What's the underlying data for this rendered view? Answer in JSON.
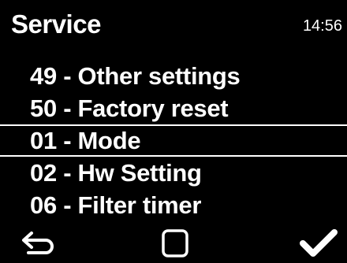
{
  "header": {
    "title": "Service",
    "time": "14:56"
  },
  "menu": {
    "items": [
      {
        "label": "49 - Other settings",
        "selected": false
      },
      {
        "label": "50 - Factory reset",
        "selected": false
      },
      {
        "label": "01 - Mode",
        "selected": true
      },
      {
        "label": "02 - Hw Setting",
        "selected": false
      },
      {
        "label": "06 - Filter timer",
        "selected": false
      }
    ]
  },
  "footer": {
    "buttons": [
      {
        "name": "back",
        "icon": "back-arrow-icon"
      },
      {
        "name": "home",
        "icon": "square-icon"
      },
      {
        "name": "confirm",
        "icon": "checkmark-icon"
      }
    ]
  },
  "colors": {
    "background": "#000000",
    "foreground": "#ffffff"
  }
}
